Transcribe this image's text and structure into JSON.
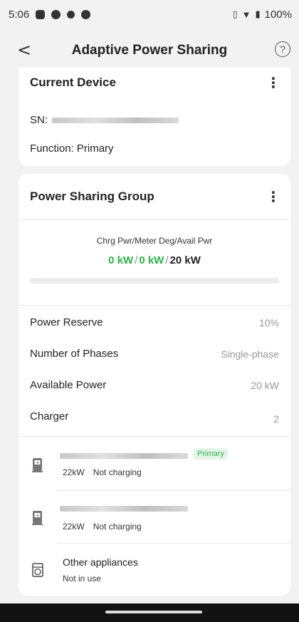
{
  "status": {
    "time": "5:06",
    "battery": "100%"
  },
  "header": {
    "title": "Adaptive Power Sharing"
  },
  "current_device": {
    "title": "Current Device",
    "sn_label": "SN:",
    "function_text": "Function: Primary"
  },
  "group": {
    "title": "Power Sharing Group",
    "chart_label": "Chrg Pwr/Meter Deg/Avail Pwr",
    "charging_power": "0 kW",
    "meter_degree": "0 kW",
    "available_power": "20 kW",
    "progress_fraction": 0.0,
    "properties": [
      {
        "label": "Power Reserve",
        "value": "10%"
      },
      {
        "label": "Number of Phases",
        "value": "Single-phase"
      },
      {
        "label": "Available Power",
        "value": "20 kW"
      },
      {
        "label": "Charger",
        "value": "2"
      }
    ],
    "devices": [
      {
        "badge": "Primary",
        "power": "22kW",
        "status": "Not charging"
      },
      {
        "power": "22kW",
        "status": "Not charging"
      }
    ],
    "other": {
      "name": "Other appliances",
      "status": "Not in use"
    }
  },
  "colors": {
    "accent": "#2fb34a",
    "background": "#f2f2f2"
  }
}
